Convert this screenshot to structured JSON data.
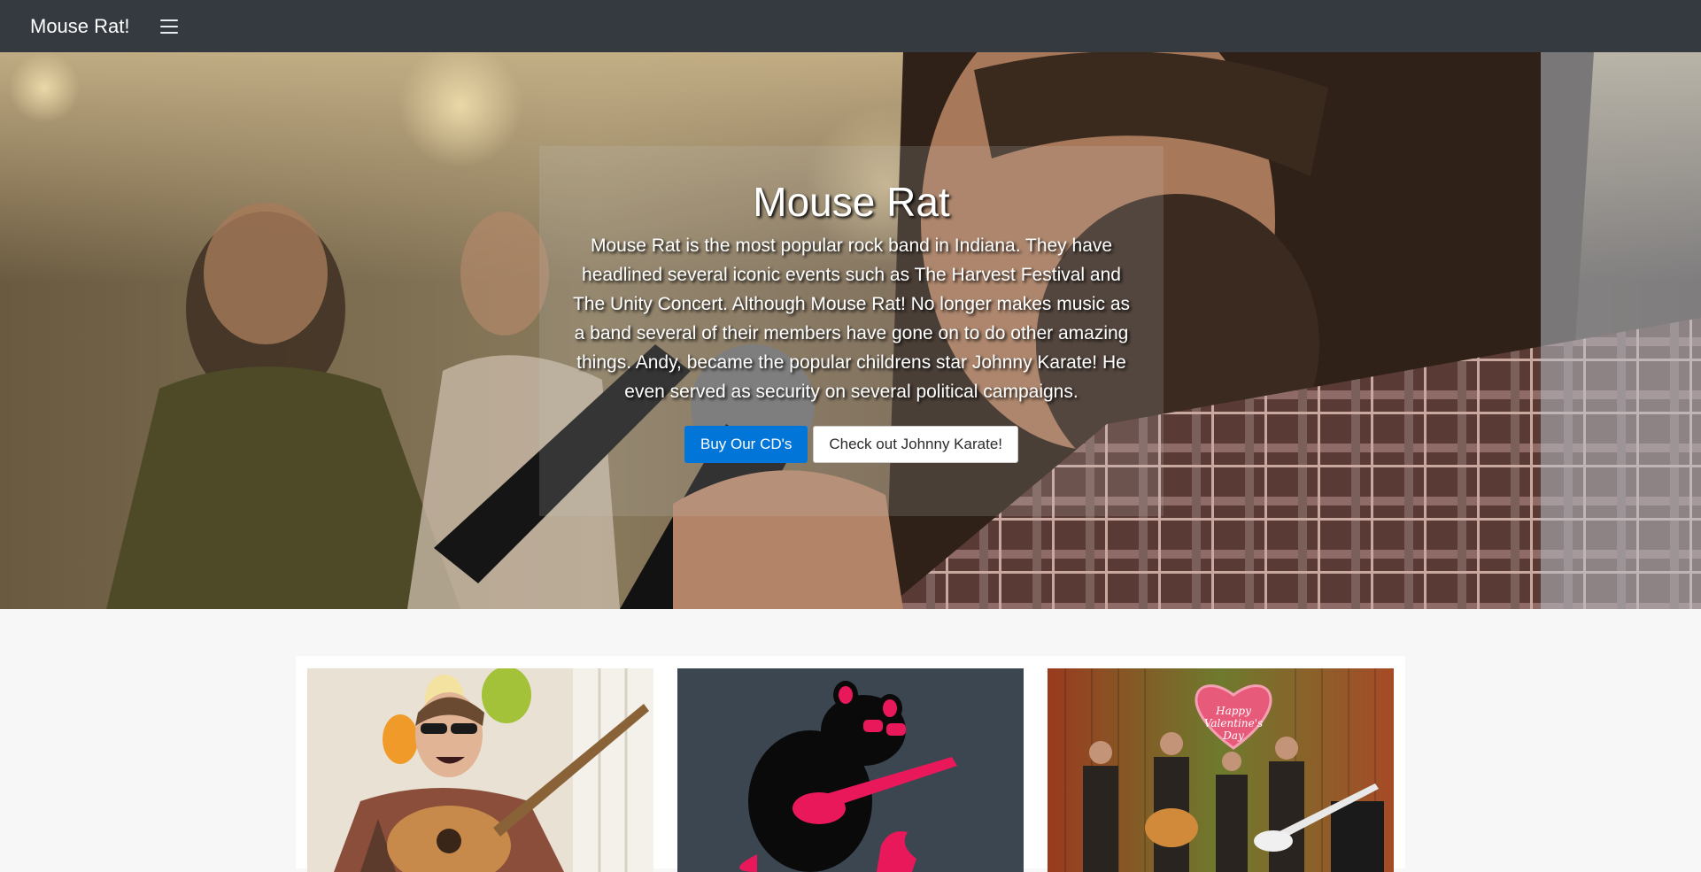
{
  "navbar": {
    "brand": "Mouse Rat!",
    "toggler_icon": "hamburger-menu-icon"
  },
  "hero": {
    "title": "Mouse Rat",
    "text": "Mouse Rat is the most popular rock band in Indiana. They have headlined several iconic events such as The Harvest Festival and The Unity Concert. Although Mouse Rat! No longer makes music as a band several of their members have gone on to do other amazing things. Andy, became the popular childrens star Johnny Karate! He even served as security on several political campaigns.",
    "primary_button": "Buy Our CD's",
    "secondary_button": "Check out Johnny Karate!"
  },
  "cards": [
    {
      "image": "guitarist-party-photo"
    },
    {
      "image": "mouse-rat-logo"
    },
    {
      "image": "band-valentines-stage-photo",
      "sign_text": "Happy Valentine's Day"
    }
  ],
  "colors": {
    "navbar": "#343a40",
    "primary": "#0275d8",
    "page_bg": "#f7f7f7",
    "logo_bg": "#3b4650",
    "logo_pink": "#e8185a"
  }
}
